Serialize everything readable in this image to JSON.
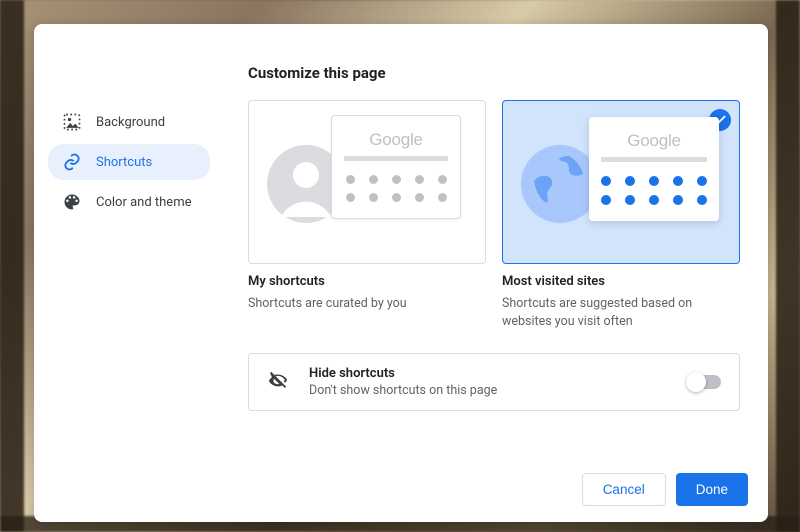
{
  "dialog": {
    "title": "Customize this page",
    "sidebar": {
      "items": [
        {
          "label": "Background",
          "selected": false
        },
        {
          "label": "Shortcuts",
          "selected": true
        },
        {
          "label": "Color and theme",
          "selected": false
        }
      ]
    },
    "options": {
      "brand_logo_text": "Google",
      "my_shortcuts": {
        "title": "My shortcuts",
        "desc": "Shortcuts are curated by you",
        "selected": false
      },
      "most_visited": {
        "title": "Most visited sites",
        "desc": "Shortcuts are suggested based on websites you visit often",
        "selected": true
      }
    },
    "hide": {
      "title": "Hide shortcuts",
      "desc": "Don't show shortcuts on this page",
      "enabled": false
    },
    "footer": {
      "cancel": "Cancel",
      "done": "Done"
    }
  }
}
